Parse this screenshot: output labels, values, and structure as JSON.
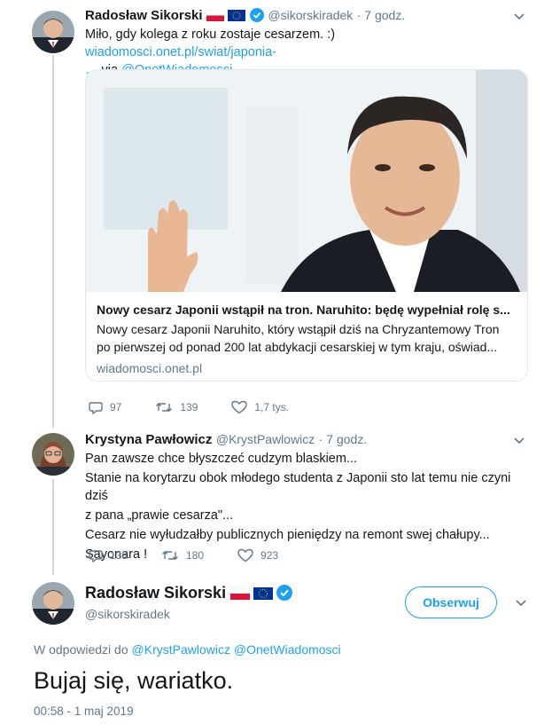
{
  "tweets": [
    {
      "author": "Radosław Sikorski",
      "handle": "@sikorskiradek",
      "time": "· 7 godz.",
      "text_line1": "Miło, gdy kolega z roku zostaje cesarzem. :) ",
      "link_part1": "wiadomosci.onet.pl/swiat/japonia-",
      "link_part2": "…",
      "via": " via ",
      "via_link": "@OnetWiadomosci",
      "card": {
        "title": "Nowy cesarz Japonii wstąpił na tron. Naruhito: będę wypełniał rolę s...",
        "desc_line1": "Nowy cesarz Japonii Naruhito, który wstąpił dziś na Chryzantemowy Tron",
        "desc_line2": "po pierwszej od ponad 200 lat abdykacji cesarskiej w tym kraju, oświad...",
        "domain": "wiadomosci.onet.pl"
      },
      "replies": "97",
      "retweets": "139",
      "likes": "1,7 tys."
    },
    {
      "author": "Krystyna Pawłowicz",
      "handle": "@KrystPawlowicz",
      "time": "· 7 godz.",
      "lines": [
        "Pan zawsze chce błyszczeć cudzym blaskiem...",
        "Stanie na korytarzu obok młodego studenta z Japonii sto lat temu nie czyni dziś",
        "z pana „prawie cesarza\"...",
        "Cesarz nie wyłudzałby publicznych pieniędzy na remont swej chałupy...",
        "Sayonara !"
      ],
      "replies": "138",
      "retweets": "180",
      "likes": "923"
    }
  ],
  "main": {
    "author": "Radosław Sikorski",
    "handle": "@sikorskiradek",
    "follow_label": "Obserwuj",
    "reply_prefix": "W odpowiedzi do ",
    "reply_user1": "@KrystPawlowicz",
    "reply_user2": " @OnetWiadomosci",
    "text": "Bujaj się, wariatko.",
    "timestamp": "00:58 - 1 maj 2019"
  },
  "colors": {
    "accent": "#1da1f2",
    "secondary_text": "#657786",
    "verified": "#1da1f2"
  },
  "icons": [
    "reply-icon",
    "retweet-icon",
    "like-icon",
    "verified-icon",
    "chevron-down-icon",
    "poland-flag-icon",
    "eu-flag-icon"
  ]
}
